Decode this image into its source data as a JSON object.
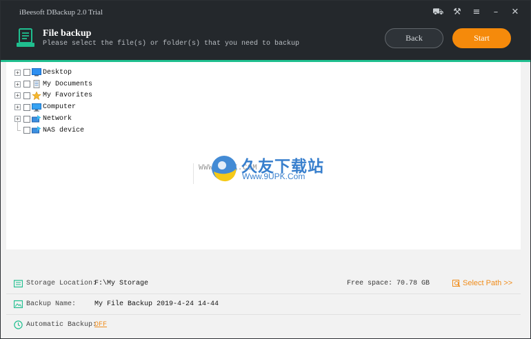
{
  "window": {
    "title": "iBeesoft DBackup 2.0 Trial",
    "controls": [
      {
        "name": "cart-icon",
        "glyph": "⛟"
      },
      {
        "name": "key-icon",
        "glyph": "⚒"
      },
      {
        "name": "menu-icon",
        "glyph": "≡"
      },
      {
        "name": "minimize-icon",
        "glyph": "–"
      },
      {
        "name": "close-icon",
        "glyph": "✕"
      }
    ]
  },
  "header": {
    "title": "File backup",
    "subtitle": "Please select the file(s) or folder(s) that you need to backup",
    "back_label": "Back",
    "start_label": "Start",
    "accent_color": "#1fbf8f",
    "start_color": "#f58a0b"
  },
  "tree": {
    "items": [
      {
        "label": "Desktop",
        "icon": "desktop-icon",
        "expandable": true
      },
      {
        "label": "My Documents",
        "icon": "documents-icon",
        "expandable": true
      },
      {
        "label": "My Favorites",
        "icon": "star-icon",
        "expandable": true
      },
      {
        "label": "Computer",
        "icon": "computer-icon",
        "expandable": true
      },
      {
        "label": "Network",
        "icon": "network-icon",
        "expandable": true
      },
      {
        "label": "NAS device",
        "icon": "nas-icon",
        "expandable": false
      }
    ]
  },
  "watermark": {
    "small_text": "WWW.9UPK.COM",
    "big_text": "久友下载站",
    "url": "Www.9UPK.Com"
  },
  "bottom": {
    "storage_label": "Storage Location:",
    "storage_value": "F:\\My Storage",
    "free_space": "Free space: 70.78 GB",
    "select_path": "Select Path >>",
    "backup_name_label": "Backup Name:",
    "backup_name_value": "My File Backup 2019-4-24 14-44",
    "auto_label": "Automatic Backup:",
    "auto_value": "OFF"
  }
}
